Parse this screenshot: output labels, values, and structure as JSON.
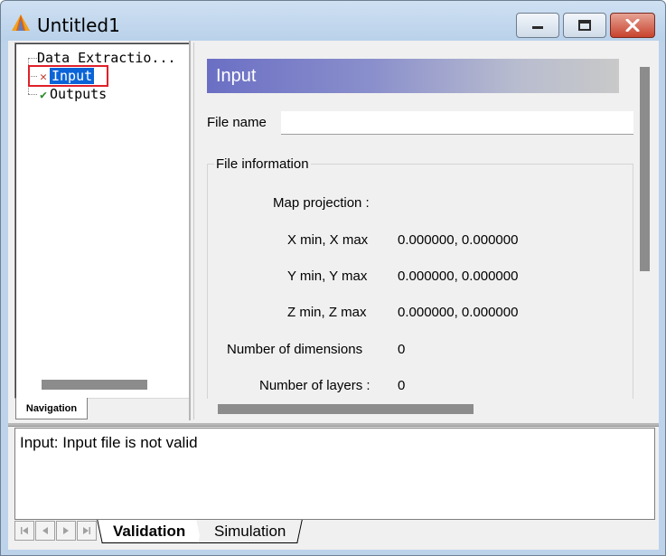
{
  "window": {
    "title": "Untitled1"
  },
  "navigation": {
    "tab_label": "Navigation",
    "tree": {
      "root": "Data Extractio...",
      "items": [
        {
          "label": "Input",
          "status": "error",
          "selected": true
        },
        {
          "label": "Outputs",
          "status": "ok",
          "selected": false
        }
      ]
    }
  },
  "form": {
    "header": "Input",
    "file_name_label": "File name",
    "file_name_value": "",
    "group_title": "File information",
    "fields": [
      {
        "label": "Map projection :",
        "value": ""
      },
      {
        "label": "X min, X max",
        "value": "0.000000, 0.000000"
      },
      {
        "label": "Y min, Y max",
        "value": "0.000000, 0.000000"
      },
      {
        "label": "Z min, Z max",
        "value": "0.000000, 0.000000"
      },
      {
        "label": "Number of dimensions",
        "value": "0"
      },
      {
        "label": "Number of layers :",
        "value": "0"
      }
    ]
  },
  "messages": {
    "text": "Input: Input file is not valid"
  },
  "bottom_tabs": [
    {
      "label": "Validation",
      "active": true
    },
    {
      "label": "Simulation",
      "active": false
    }
  ],
  "icons": {
    "error_mark": "✕",
    "ok_mark": "✔"
  },
  "colors": {
    "header_gradient_start": "#6b6fc4",
    "selection": "#0a64d8",
    "highlight_border": "#e0202a",
    "close_button": "#c8432d"
  }
}
